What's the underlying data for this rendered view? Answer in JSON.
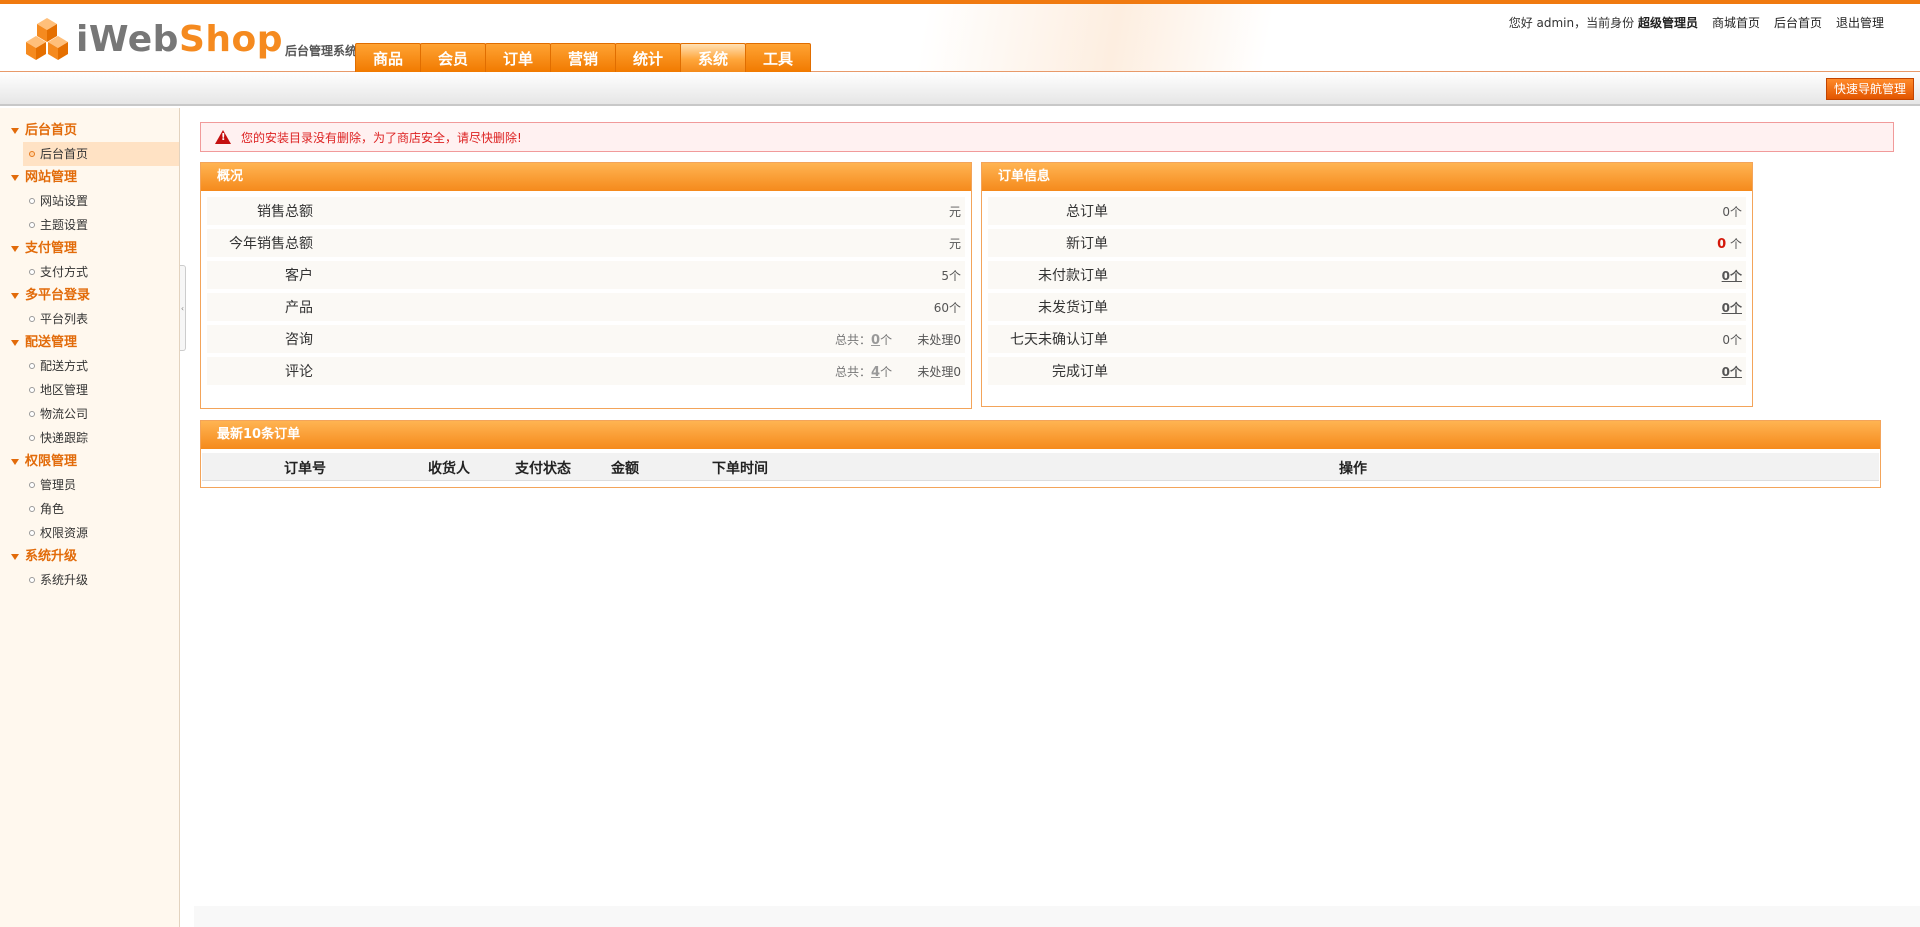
{
  "header": {
    "logo_text_a": "iWeb",
    "logo_text_b": "Shop",
    "logo_sub": "后台管理系统",
    "tabs": [
      {
        "label": "商品"
      },
      {
        "label": "会员"
      },
      {
        "label": "订单"
      },
      {
        "label": "营销"
      },
      {
        "label": "统计"
      },
      {
        "label": "系统"
      },
      {
        "label": "工具"
      }
    ],
    "active_tab": "系统",
    "greeting": "您好 admin，当前身份",
    "role": "超级管理员",
    "links": [
      "商城首页",
      "后台首页",
      "退出管理"
    ]
  },
  "subbar": {
    "quick_nav_label": "快速导航管理"
  },
  "sidebar": {
    "groups": [
      {
        "title": "后台首页",
        "items": [
          "后台首页"
        ]
      },
      {
        "title": "网站管理",
        "items": [
          "网站设置",
          "主题设置"
        ]
      },
      {
        "title": "支付管理",
        "items": [
          "支付方式"
        ]
      },
      {
        "title": "多平台登录",
        "items": [
          "平台列表"
        ]
      },
      {
        "title": "配送管理",
        "items": [
          "配送方式",
          "地区管理",
          "物流公司",
          "快递跟踪"
        ]
      },
      {
        "title": "权限管理",
        "items": [
          "管理员",
          "角色",
          "权限资源"
        ]
      },
      {
        "title": "系统升级",
        "items": [
          "系统升级"
        ]
      }
    ],
    "active_item": "后台首页"
  },
  "alert": {
    "text": "您的安装目录没有删除，为了商店安全，请尽快删除!"
  },
  "overview": {
    "title": "概况",
    "rows": [
      {
        "label": "销售总额",
        "value": "元"
      },
      {
        "label": "今年销售总额",
        "value": "元"
      },
      {
        "label": "客户",
        "value": "5个"
      },
      {
        "label": "产品",
        "value": "60个"
      },
      {
        "label": "咨询",
        "total_label": "总共：",
        "total": "0",
        "unit": "个",
        "pending": "未处理0"
      },
      {
        "label": "评论",
        "total_label": "总共：",
        "total": "4",
        "unit": "个",
        "pending": "未处理0"
      }
    ]
  },
  "order_info": {
    "title": "订单信息",
    "rows": [
      {
        "label": "总订单",
        "value": "0个"
      },
      {
        "label": "新订单",
        "count": "0",
        "unit": "个"
      },
      {
        "label": "未付款订单",
        "value": "0个"
      },
      {
        "label": "未发货订单",
        "value": "0个"
      },
      {
        "label": "七天未确认订单",
        "value": "0个"
      },
      {
        "label": "完成订单",
        "value": "0个"
      }
    ]
  },
  "latest_orders": {
    "title": "最新10条订单",
    "columns": [
      "订单号",
      "收货人",
      "支付状态",
      "金额",
      "下单时间",
      "操作"
    ]
  }
}
